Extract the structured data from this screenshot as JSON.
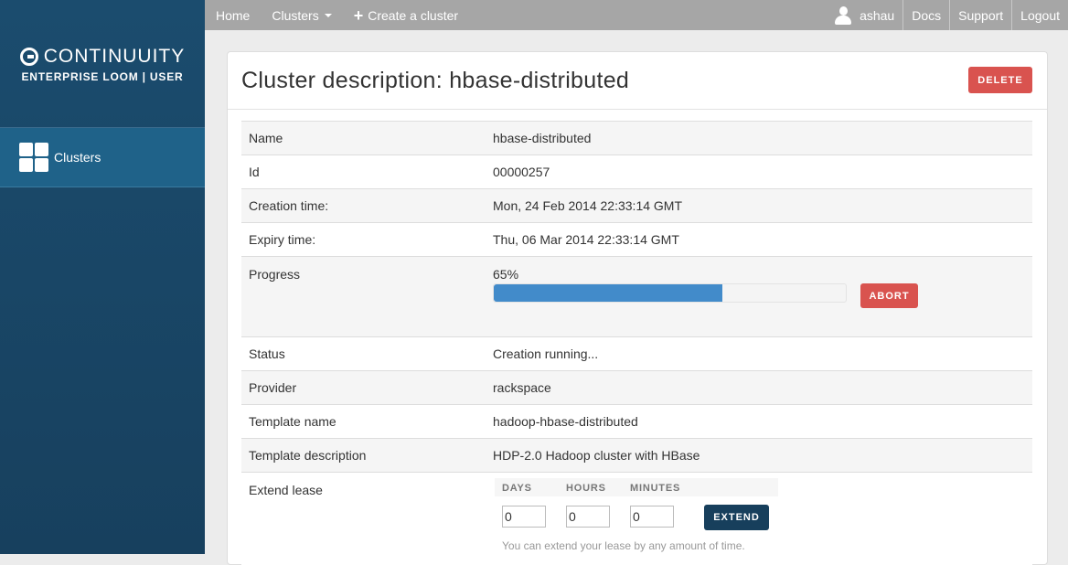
{
  "brand": {
    "name": "CONTINUUITY",
    "subtitle": "ENTERPRISE LOOM | USER"
  },
  "sidebar": {
    "items": [
      {
        "label": "Clusters",
        "icon": "grid-icon"
      }
    ]
  },
  "nav": {
    "home": "Home",
    "clusters": "Clusters",
    "create": "Create a cluster",
    "user": "ashau",
    "docs": "Docs",
    "support": "Support",
    "logout": "Logout"
  },
  "panel": {
    "title": "Cluster description: hbase-distributed",
    "delete_label": "DELETE"
  },
  "details": {
    "name": {
      "key": "Name",
      "value": "hbase-distributed"
    },
    "id": {
      "key": "Id",
      "value": "00000257"
    },
    "creation": {
      "key": "Creation time:",
      "value": "Mon, 24 Feb 2014 22:33:14 GMT"
    },
    "expiry": {
      "key": "Expiry time:",
      "value": "Thu, 06 Mar 2014 22:33:14 GMT"
    },
    "progress": {
      "key": "Progress",
      "value": "65%",
      "fraction": 0.65,
      "abort_label": "ABORT"
    },
    "status": {
      "key": "Status",
      "value": "Creation running..."
    },
    "provider": {
      "key": "Provider",
      "value": "rackspace"
    },
    "template_name": {
      "key": "Template name",
      "value": "hadoop-hbase-distributed"
    },
    "template_desc": {
      "key": "Template description",
      "value": "HDP-2.0 Hadoop cluster with HBase"
    }
  },
  "lease": {
    "key": "Extend lease",
    "days_label": "DAYS",
    "hours_label": "HOURS",
    "minutes_label": "MINUTES",
    "days": "0",
    "hours": "0",
    "minutes": "0",
    "extend_label": "EXTEND",
    "help": "You can extend your lease by any amount of time."
  },
  "colors": {
    "accent": "#428bca",
    "danger": "#d9534f",
    "sidebar": "#1b4c6e",
    "nav": "#a6a6a6"
  }
}
